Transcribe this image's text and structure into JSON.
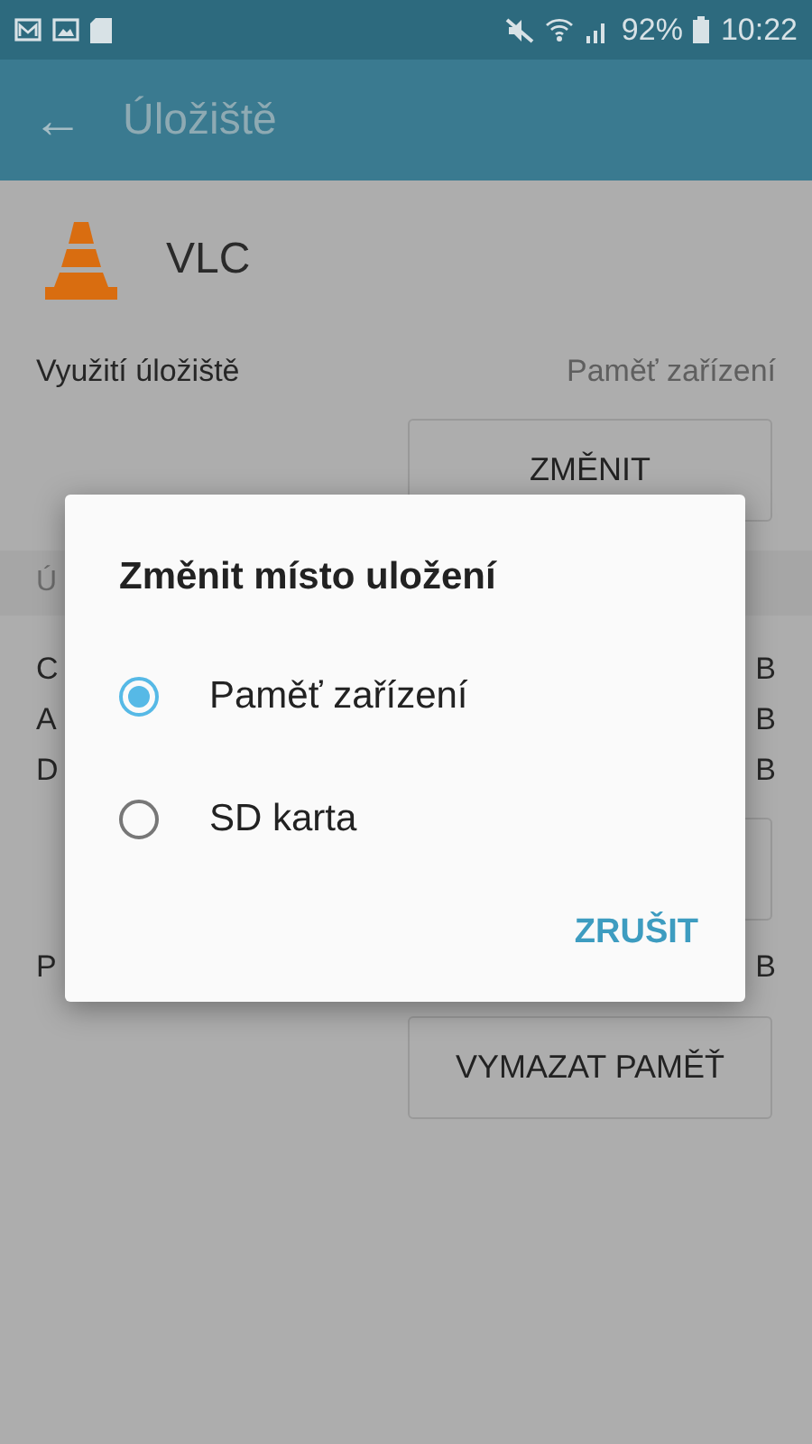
{
  "status_bar": {
    "battery": "92%",
    "time": "10:22"
  },
  "app_bar": {
    "back": "←",
    "title": "Úložiště"
  },
  "app": {
    "name": "VLC"
  },
  "storage_used": {
    "label": "Využití úložiště",
    "value": "Paměť zařízení",
    "button": "ZMĚNIT"
  },
  "section_header": "Ú",
  "rows": [
    {
      "label": "C",
      "value": "B"
    },
    {
      "label": "A",
      "value": "B"
    },
    {
      "label": "D",
      "value": "B"
    }
  ],
  "cache_row": {
    "label": "P",
    "value": "B"
  },
  "clear_button": "VYMAZAT PAMĚŤ",
  "dialog": {
    "title": "Změnit místo uložení",
    "options": [
      {
        "label": "Paměť zařízení",
        "selected": true
      },
      {
        "label": "SD karta",
        "selected": false
      }
    ],
    "cancel": "ZRUŠIT"
  }
}
